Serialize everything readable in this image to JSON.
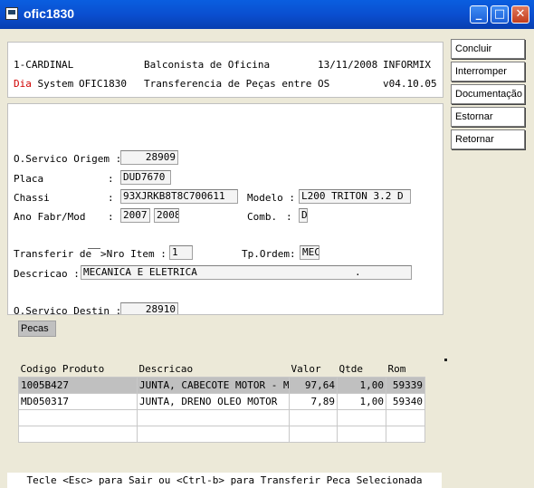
{
  "window": {
    "title": "ofic1830"
  },
  "header": {
    "company": "1-CARDINAL",
    "role": "Balconista de Oficina",
    "date": "13/11/2008",
    "db": "INFORMIX",
    "brand_red": "Dia",
    "brand_rest": " System",
    "program": "OFIC1830",
    "screen_title": "Transferencia de Peças entre OS",
    "version": "v04.10.05"
  },
  "form": {
    "os_origem_label": "O.Servico Origem :",
    "os_origem_value": "28909",
    "placa_label": "Placa",
    "placa_colon": ":",
    "placa_value": "DUD7670",
    "chassi_label": "Chassi",
    "chassi_colon": ":",
    "chassi_value": "93XJRKB8T8C700611",
    "modelo_label": "Modelo :",
    "modelo_value": "L200 TRITON 3.2 D",
    "ano_label": "Ano Fabr/Mod",
    "ano_colon": ":",
    "ano_fabr": "2007",
    "ano_mod": "2008",
    "comb_label": "Comb.",
    "comb_colon": ":",
    "comb_value": "D",
    "transferir_label": "Transferir de",
    "nro_item_label": ">Nro Item :",
    "nro_item_value": "1",
    "tp_ordem_label": "Tp.Ordem:",
    "tp_ordem_value": "MEC",
    "descricao_label": "Descricao :",
    "descricao_value": "MECANICA E ELETRICA",
    "descricao_dot": ".",
    "os_destino_label": "O.Servico Destin :",
    "os_destino_value": "28910"
  },
  "actions": [
    "Concluir",
    "Interromper",
    "Documentação",
    "Estornar",
    "Retornar"
  ],
  "pecas": {
    "tab_label": "Pecas",
    "columns": [
      "Codigo Produto",
      "Descricao",
      "Valor",
      "Qtde",
      "Rom"
    ],
    "rows": [
      [
        "1005B427",
        "JUNTA, CABECOTE MOTOR - MET",
        "97,64",
        "1,00",
        "59339"
      ],
      [
        "MD050317",
        "JUNTA, DRENO OLEO MOTOR",
        "7,89",
        "1,00",
        "59340"
      ]
    ]
  },
  "status": "Tecle <Esc> para Sair ou <Ctrl-b> para Transferir Peca Selecionada"
}
